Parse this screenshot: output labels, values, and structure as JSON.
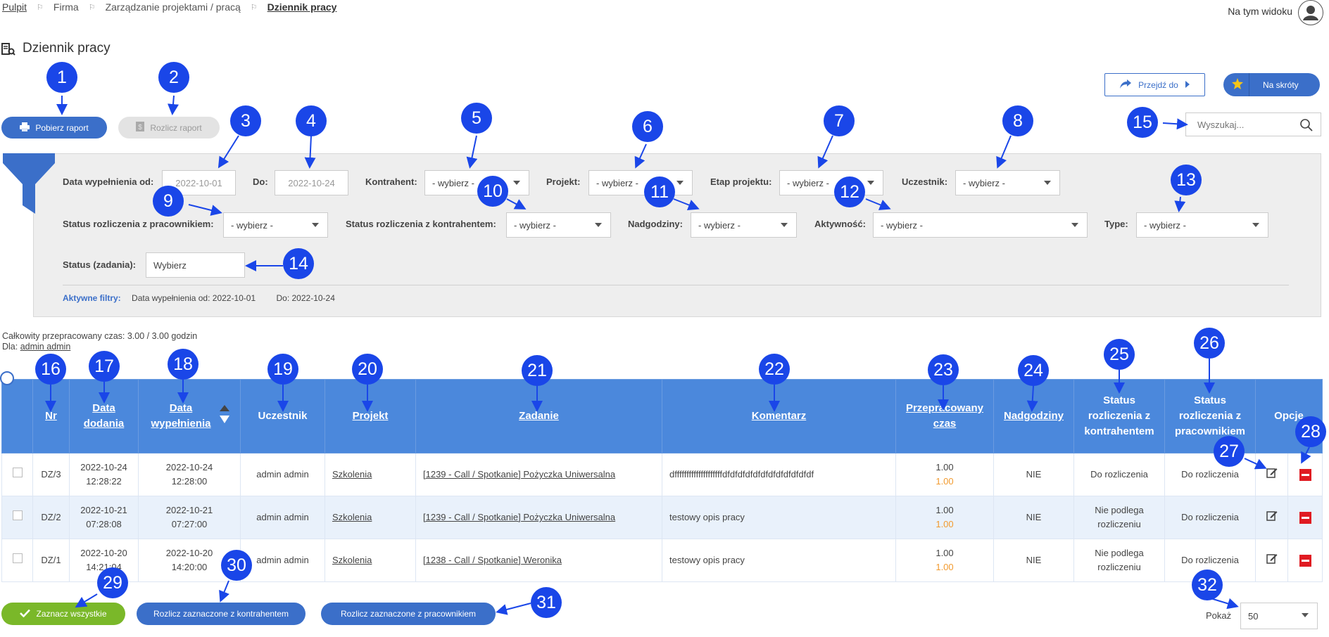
{
  "breadcrumb": {
    "items": [
      "Pulpit",
      "Firma",
      "Zarządzanie projektami / pracą",
      "Dziennik pracy"
    ]
  },
  "header": {
    "view_label": "Na tym widoku",
    "title": "Dziennik pracy"
  },
  "toolbar": {
    "download_report": "Pobierz raport",
    "settle_report": "Rozlicz raport",
    "go_to": "Przejdź do",
    "shortcuts": "Na skróty"
  },
  "search": {
    "placeholder": "Wyszukaj..."
  },
  "filters": {
    "date_from_label": "Data wypełnienia od:",
    "date_from_value": "2022-10-01",
    "date_to_label": "Do:",
    "date_to_value": "2022-10-24",
    "contractor_label": "Kontrahent:",
    "project_label": "Projekt:",
    "stage_label": "Etap projektu:",
    "participant_label": "Uczestnik:",
    "emp_status_label": "Status rozliczenia z pracownikiem:",
    "contr_status_label": "Status rozliczenia z kontrahentem:",
    "overtime_label": "Nadgodziny:",
    "activity_label": "Aktywność:",
    "type_label": "Type:",
    "task_status_label": "Status (zadania):",
    "task_status_value": "Wybierz",
    "select_default": "- wybierz -",
    "active_label": "Aktywne filtry:",
    "active_from": "Data wypełnienia od: 2022-10-01",
    "active_to": "Do: 2022-10-24"
  },
  "summary": {
    "total": "Całkowity przepracowany czas: 3.00 / 3.00 godzin",
    "for_label": "Dla:",
    "for_user": "admin admin"
  },
  "table": {
    "headers": {
      "nr": "Nr",
      "added": "Data dodania",
      "filled": "Data wypełnienia",
      "participant": "Uczestnik",
      "project": "Projekt",
      "task": "Zadanie",
      "comment": "Komentarz",
      "worked": "Przepracowany czas",
      "overtime": "Nadgodziny",
      "contr_status": "Status rozliczenia z kontrahentem",
      "emp_status": "Status rozliczenia z pracownikiem",
      "options": "Opcje"
    },
    "rows": [
      {
        "nr": "DZ/3",
        "added_date": "2022-10-24",
        "added_time": "12:28:22",
        "filled_date": "2022-10-24",
        "filled_time": "12:28:00",
        "participant": "admin admin",
        "project": "Szkolenia",
        "task": "[1239 - Call / Spotkanie] Pożyczka Uniwersalna",
        "comment": "dffffffffffffffffffffdfdfdfdfdfdfdfdfdfdfdfdf",
        "worked": "1.00",
        "worked2": "1.00",
        "overtime": "NIE",
        "contr_status": "Do rozliczenia",
        "emp_status": "Do rozliczenia"
      },
      {
        "nr": "DZ/2",
        "added_date": "2022-10-21",
        "added_time": "07:28:08",
        "filled_date": "2022-10-21",
        "filled_time": "07:27:00",
        "participant": "admin admin",
        "project": "Szkolenia",
        "task": "[1239 - Call / Spotkanie] Pożyczka Uniwersalna",
        "comment": "testowy opis pracy",
        "worked": "1.00",
        "worked2": "1.00",
        "overtime": "NIE",
        "contr_status": "Nie podlega rozliczeniu",
        "emp_status": "Do rozliczenia"
      },
      {
        "nr": "DZ/1",
        "added_date": "2022-10-20",
        "added_time": "14:21:04",
        "filled_date": "2022-10-20",
        "filled_time": "14:20:00",
        "participant": "admin admin",
        "project": "Szkolenia",
        "task": "[1238 - Call / Spotkanie] Weronika",
        "comment": "testowy opis pracy",
        "worked": "1.00",
        "worked2": "1.00",
        "overtime": "NIE",
        "contr_status": "Nie podlega rozliczeniu",
        "emp_status": "Do rozliczenia"
      }
    ]
  },
  "footer": {
    "select_all": "Zaznacz wszystkie",
    "settle_contr": "Rozlicz zaznaczone z kontrahentem",
    "settle_emp": "Rozlicz zaznaczone z pracownikiem",
    "show_label": "Pokaż",
    "page_size": "50"
  },
  "callouts": [
    "1",
    "2",
    "3",
    "4",
    "5",
    "6",
    "7",
    "8",
    "9",
    "10",
    "11",
    "12",
    "13",
    "14",
    "15",
    "16",
    "17",
    "18",
    "19",
    "20",
    "21",
    "22",
    "23",
    "24",
    "25",
    "26",
    "27",
    "28",
    "29",
    "30",
    "31",
    "32"
  ],
  "colors": {
    "primary": "#3b6fc9",
    "header": "#4b88dc",
    "callout": "#1a46e8",
    "green": "#7ab829",
    "danger": "#e01b22",
    "orange": "#f29a2e"
  }
}
